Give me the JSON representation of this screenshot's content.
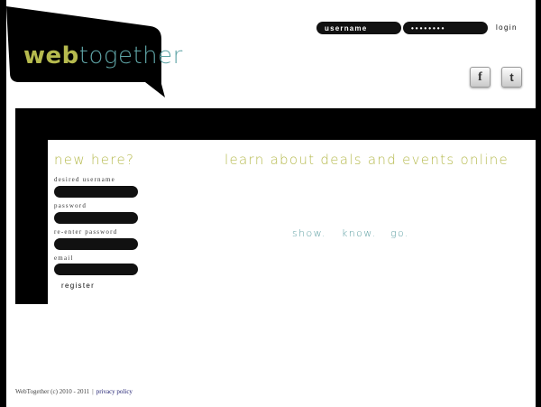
{
  "logo": {
    "part1": "web",
    "part2": "together"
  },
  "login": {
    "username_value": "username",
    "password_value": "••••••••",
    "button_label": "login"
  },
  "social": {
    "facebook_glyph": "f",
    "twitter_glyph": "t"
  },
  "register": {
    "title": "new here?",
    "fields": [
      {
        "label": "desired username"
      },
      {
        "label": "password"
      },
      {
        "label": "re-enter password"
      },
      {
        "label": "email"
      }
    ],
    "button_label": "register"
  },
  "main": {
    "headline": "learn about deals and events online",
    "taglines": [
      "show.",
      "know.",
      "go."
    ]
  },
  "footer": {
    "copyright": "WebTogether (c) 2010 - 2011",
    "separator": "|",
    "privacy_link": "privacy policy"
  },
  "colors": {
    "accent_olive": "#b6ba4e",
    "accent_teal": "#5fa4a6",
    "band": "#000000",
    "input_fill": "#111111"
  }
}
